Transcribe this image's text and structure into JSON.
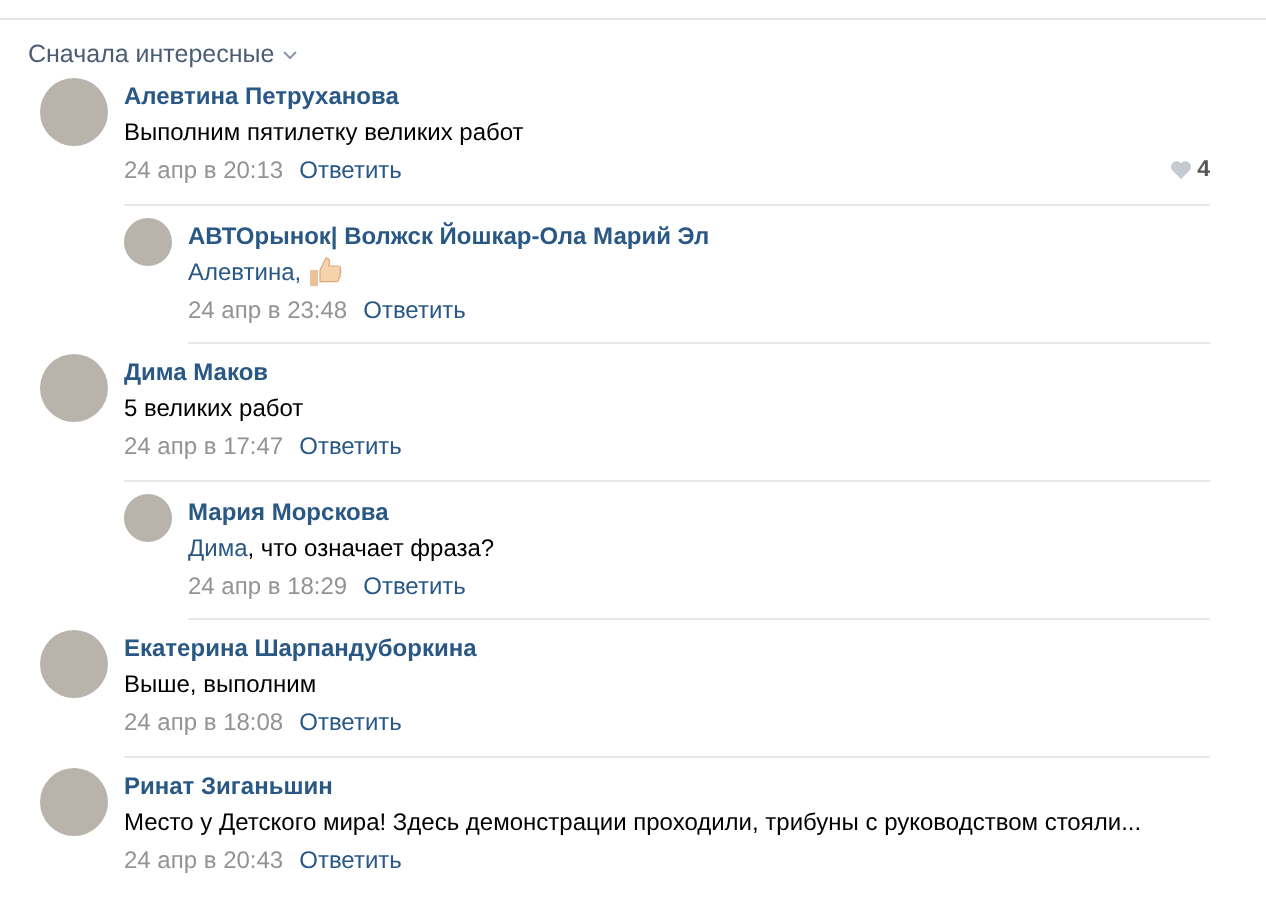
{
  "sort": {
    "label": "Сначала интересные"
  },
  "comments": [
    {
      "author": "Алевтина Петруханова",
      "text": "Выполним пятилетку великих работ",
      "date": "24 апр в 20:13",
      "reply_label": "Ответить",
      "likes": "4",
      "replies": [
        {
          "author": "АВТОрынок| Волжск Йошкар-Ола Марий Эл",
          "mention": "Алевтина,",
          "has_emoji": true,
          "date": "24 апр в 23:48",
          "reply_label": "Ответить"
        }
      ]
    },
    {
      "author": "Дима Маков",
      "text": "5 великих работ",
      "date": "24 апр в 17:47",
      "reply_label": "Ответить",
      "replies": [
        {
          "author": "Мария Морскова",
          "mention": "Дима",
          "text": ", что означает фраза?",
          "has_emoji": false,
          "date": "24 апр в 18:29",
          "reply_label": "Ответить"
        }
      ]
    },
    {
      "author": "Екатерина Шарпандуборкина",
      "text": "Выше, выполним",
      "date": "24 апр в 18:08",
      "reply_label": "Ответить"
    },
    {
      "author": "Ринат Зиганьшин",
      "text": "Место у Детского мира! Здесь демонстрации проходили, трибуны с руководством стояли...",
      "date": "24 апр в 20:43",
      "reply_label": "Ответить"
    }
  ]
}
